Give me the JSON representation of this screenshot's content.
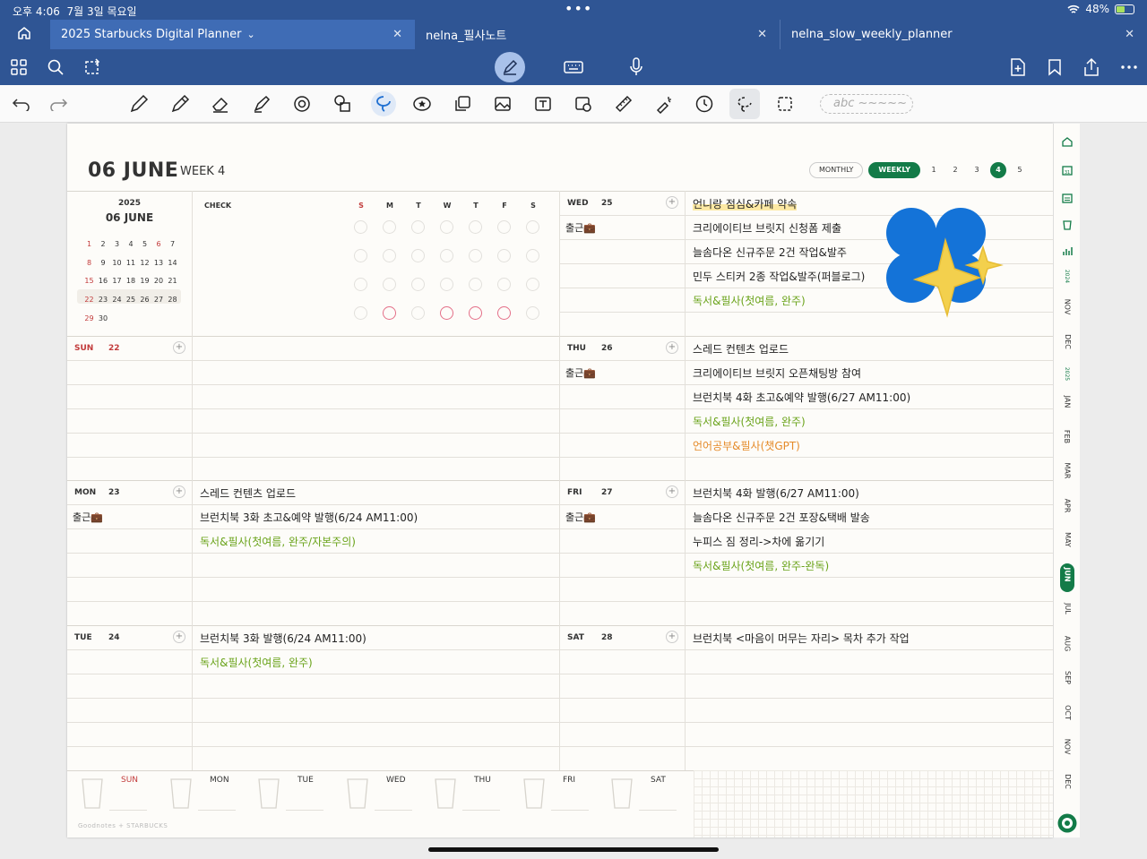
{
  "status": {
    "time": "오후 4:06",
    "date": "7월 3일 목요일",
    "battery": "48%"
  },
  "tabs": [
    {
      "label": "2025 Starbucks Digital Planner",
      "chevron": "⌄",
      "active": true
    },
    {
      "label": "nelna_필사노트",
      "active": false
    },
    {
      "label": "nelna_slow_weekly_planner",
      "active": false
    }
  ],
  "toolbar_icons": [
    "grid-icon",
    "search-icon",
    "lasso-rotate-icon",
    "pen-mode-icon",
    "keyboard-icon",
    "mic-icon",
    "add-page-icon",
    "bookmark-icon",
    "share-icon",
    "more-icon"
  ],
  "tools": [
    "undo-icon",
    "redo-icon",
    "pen-icon",
    "pencil-icon",
    "eraser-icon",
    "highlighter-icon",
    "shape-icon",
    "elements-icon",
    "lasso-rope-icon",
    "sticker-icon",
    "copy-icon",
    "image-icon",
    "textbox-icon",
    "camera-icon",
    "ruler-icon",
    "laser-icon",
    "timer-icon",
    "lasso-icon",
    "select-icon"
  ],
  "abc_placeholder": "abc ~~~~~",
  "header": {
    "month": "06 JUNE",
    "week": "WEEK 4",
    "nav_monthly": "MONTHLY",
    "nav_weekly": "WEEKLY",
    "weeks": [
      "1",
      "2",
      "3",
      "4",
      "5"
    ],
    "active_week": "4"
  },
  "minical": {
    "year": "2025",
    "month": "06 JUNE",
    "rows": [
      [
        "1",
        "2",
        "3",
        "4",
        "5",
        "6",
        "7"
      ],
      [
        "8",
        "9",
        "10",
        "11",
        "12",
        "13",
        "14"
      ],
      [
        "15",
        "16",
        "17",
        "18",
        "19",
        "20",
        "21"
      ],
      [
        "22",
        "23",
        "24",
        "25",
        "26",
        "27",
        "28"
      ],
      [
        "29",
        "30"
      ]
    ]
  },
  "check": {
    "label": "CHECK",
    "days": [
      "S",
      "M",
      "T",
      "W",
      "T",
      "F",
      "S"
    ]
  },
  "days": [
    {
      "label": "SUN",
      "num": "22",
      "tasks": []
    },
    {
      "label": "MON",
      "num": "23",
      "gowork": "출근💼",
      "tasks": [
        {
          "t": "스레드 컨텐츠 업로드",
          "c": ""
        },
        {
          "t": "브런치북 3화 초고&예약 발행(6/24 AM11:00)",
          "c": ""
        },
        {
          "t": "독서&필사(첫여름, 완주/자본주의)",
          "c": "green"
        }
      ]
    },
    {
      "label": "TUE",
      "num": "24",
      "tasks": [
        {
          "t": "브런치북 3화 발행(6/24 AM11:00)",
          "c": ""
        },
        {
          "t": "독서&필사(첫여름, 완주)",
          "c": "green"
        }
      ]
    },
    {
      "label": "WED",
      "num": "25",
      "gowork": "출근💼",
      "tasks": [
        {
          "t": "언니랑 점심&카페 약속",
          "c": "hl"
        },
        {
          "t": "크리에이티브 브릿지 신청폼 제출",
          "c": ""
        },
        {
          "t": "늘솜다온 신규주문 2건 작업&발주",
          "c": ""
        },
        {
          "t": "민두 스티커 2종 작업&발주(퍼블로그)",
          "c": ""
        },
        {
          "t": "독서&필사(첫여름, 완주)",
          "c": "green"
        }
      ]
    },
    {
      "label": "THU",
      "num": "26",
      "gowork": "출근💼",
      "tasks": [
        {
          "t": "스레드 컨텐츠 업로드",
          "c": ""
        },
        {
          "t": "크리에이티브 브릿지 오픈채팅방 참여",
          "c": ""
        },
        {
          "t": "브런치북 4화 초고&예약 발행(6/27 AM11:00)",
          "c": ""
        },
        {
          "t": "독서&필사(첫여름, 완주)",
          "c": "green"
        },
        {
          "t": "언어공부&필사(챗GPT)",
          "c": "orange"
        }
      ]
    },
    {
      "label": "FRI",
      "num": "27",
      "gowork": "출근💼",
      "tasks": [
        {
          "t": "브런치북 4화 발행(6/27 AM11:00)",
          "c": ""
        },
        {
          "t": "늘솜다온 신규주문 2건 포장&택배 발송",
          "c": ""
        },
        {
          "t": "누피스 짐 정리->차에 옮기기",
          "c": ""
        },
        {
          "t": "독서&필사(첫여름, 완주-완독)",
          "c": "green"
        }
      ]
    },
    {
      "label": "SAT",
      "num": "28",
      "tasks": [
        {
          "t": "브런치북 <마음이 머무는 자리> 목차 추가 작업",
          "c": ""
        }
      ]
    }
  ],
  "habits": [
    "SUN",
    "MON",
    "TUE",
    "WED",
    "THU",
    "FRI",
    "SAT"
  ],
  "footer": "Goodnotes  +  STARBUCKS",
  "sidebar": {
    "year1": "2024",
    "months1": [
      "NOV",
      "DEC"
    ],
    "year2": "2025",
    "months2": [
      "JAN",
      "FEB",
      "MAR",
      "APR",
      "MAY",
      "JUN",
      "JUL",
      "AUG",
      "SEP",
      "OCT",
      "NOV",
      "DEC"
    ],
    "active": "JUN"
  },
  "colors": {
    "accent": "#137b48",
    "chrome": "#2f5594",
    "green_text": "#6aa31a",
    "orange_text": "#e58b2a",
    "pink": "#e46f88",
    "sticker_blue": "#1473d8",
    "sticker_yellow": "#f3d04d"
  }
}
